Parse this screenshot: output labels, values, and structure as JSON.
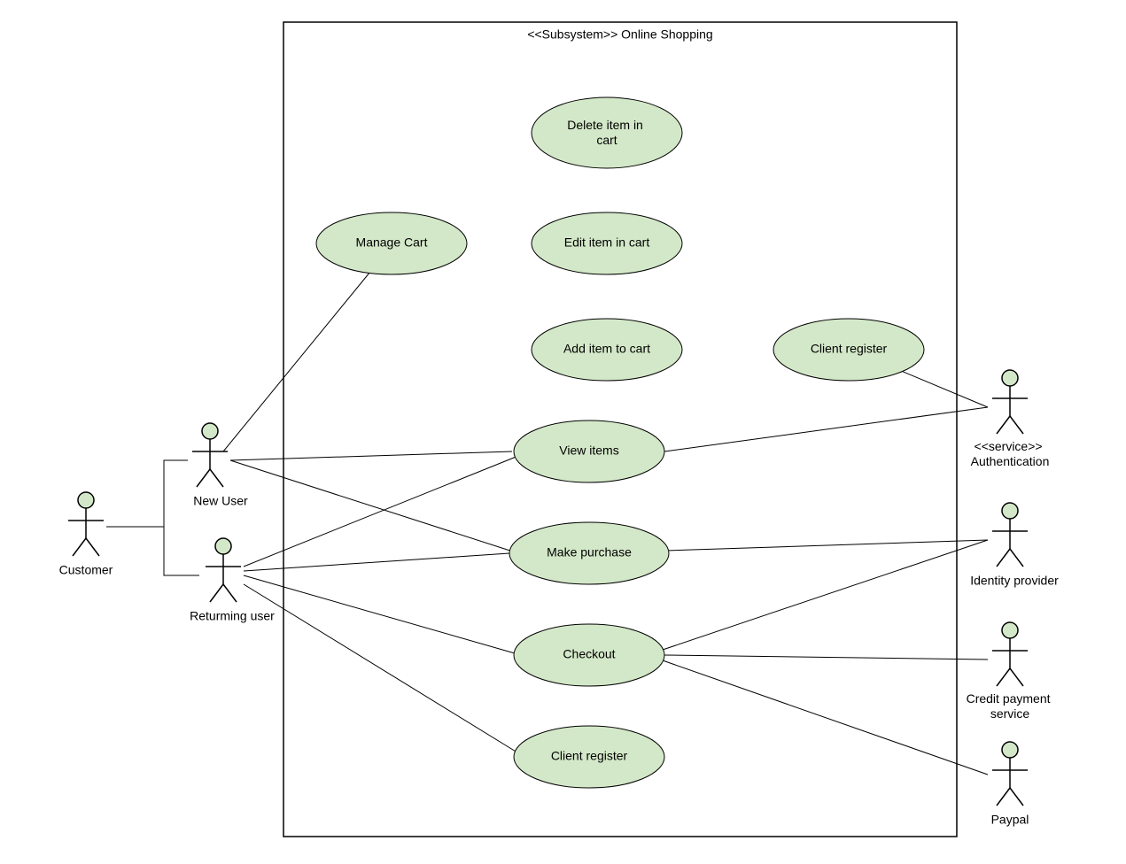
{
  "system": {
    "title": "<<Subsystem>> Online Shopping"
  },
  "actors": {
    "customer": "Customer",
    "new_user": "New User",
    "returning_user": "Returming user",
    "auth_stereotype": "<<service>>",
    "auth_name": "Authentication",
    "identity_provider": "Identity provider",
    "credit_payment_l1": "Credit payment",
    "credit_payment_l2": "service",
    "paypal": "Paypal"
  },
  "usecases": {
    "delete_item_l1": "Delete item in",
    "delete_item_l2": "cart",
    "manage_cart": "Manage Cart",
    "edit_item": "Edit item in cart",
    "add_item": "Add item to cart",
    "client_register_top": "Client register",
    "view_items": "View items",
    "make_purchase": "Make purchase",
    "checkout": "Checkout",
    "client_register_bottom": "Client register"
  }
}
